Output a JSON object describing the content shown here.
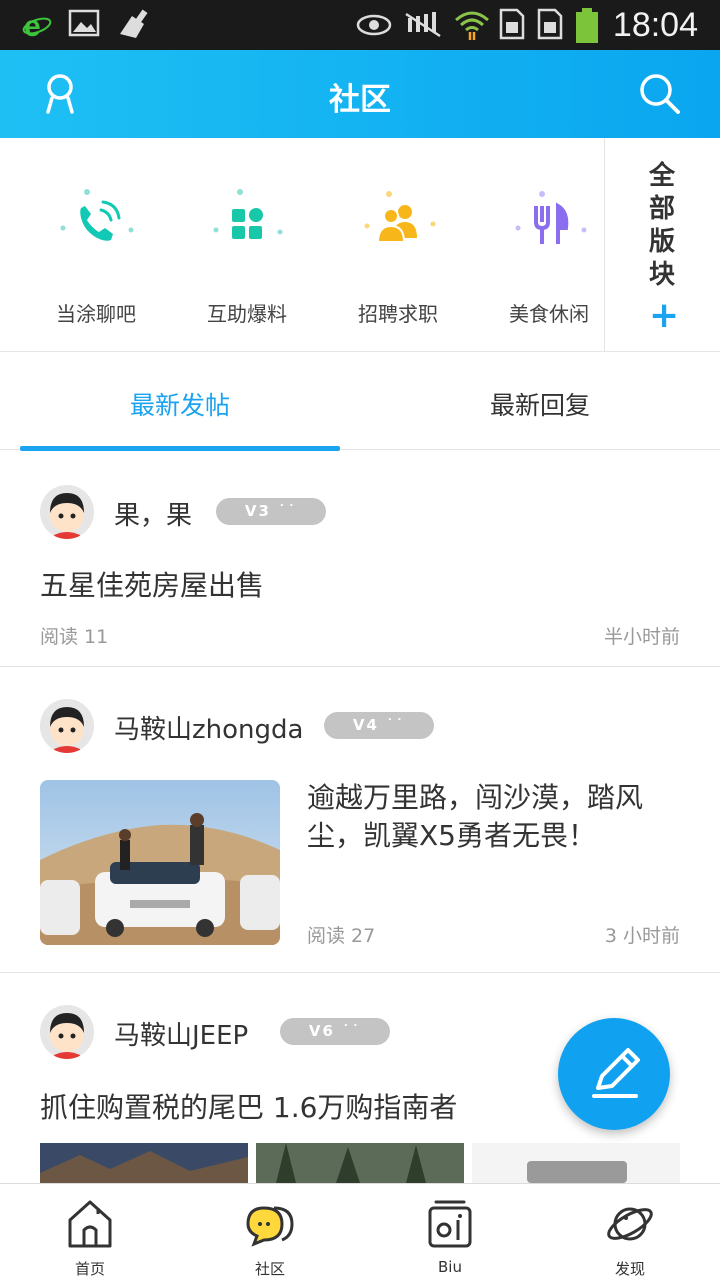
{
  "status_bar": {
    "time": "18:04"
  },
  "header": {
    "title": "社区"
  },
  "categories": [
    {
      "label": "当涂聊吧",
      "icon": "phone-icon",
      "color": "#12c9b5"
    },
    {
      "label": "互助爆料",
      "icon": "grid-icon",
      "color": "#19c7a9"
    },
    {
      "label": "招聘求职",
      "icon": "people-icon",
      "color": "#f7b61a"
    },
    {
      "label": "美食休闲",
      "icon": "fork-knife-icon",
      "color": "#8b6ef0"
    }
  ],
  "all_sections": {
    "label": "全部版块",
    "plus": "+"
  },
  "tabs": [
    {
      "label": "最新发帖",
      "active": true
    },
    {
      "label": "最新回复",
      "active": false
    }
  ],
  "posts": [
    {
      "user": "果，果",
      "level": "V3 ˙˙",
      "title": "五星佳苑房屋出售",
      "reads": "阅读 11",
      "time": "半小时前"
    },
    {
      "user": "马鞍山zhongda",
      "level": "V4 ˙˙",
      "title": "逾越万里路，闯沙漠，踏风尘，凯翼X5勇者无畏！",
      "reads": "阅读 27",
      "time": "3 小时前"
    },
    {
      "user": "马鞍山JEEP",
      "level": "V6 ˙˙",
      "title": "抓住购置税的尾巴 1.6万购指南者"
    }
  ],
  "bottom_nav": [
    {
      "label": "首页",
      "icon": "home-icon"
    },
    {
      "label": "社区",
      "icon": "chat-bubble-icon"
    },
    {
      "label": "Biu",
      "icon": "biu-icon"
    },
    {
      "label": "发现",
      "icon": "planet-icon"
    }
  ],
  "colors": {
    "accent": "#1aa3ef",
    "header": "#0aa6f0"
  }
}
